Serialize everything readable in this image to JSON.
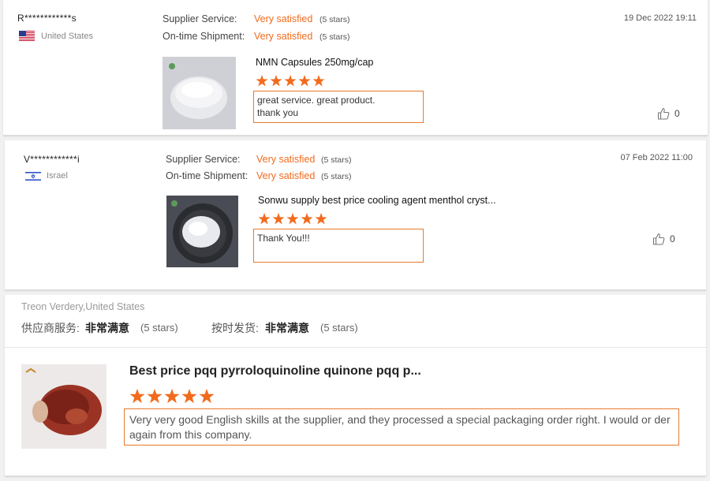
{
  "colors": {
    "accent": "#f26b1d",
    "star": "#f26b1d",
    "border": "#e77a2d"
  },
  "reviews": [
    {
      "user": "R************s",
      "country": "United States",
      "flag": "us-flag",
      "supplier_label": "Supplier Service:",
      "supplier_value": "Very satisfied",
      "supplier_stars": "(5 stars)",
      "shipment_label": "On-time Shipment:",
      "shipment_value": "Very satisfied",
      "shipment_stars": "(5 stars)",
      "date": "19 Dec 2022 19:11",
      "product": "NMN Capsules 250mg/cap",
      "rating": 5,
      "comment": "great service.  great product.\nthank you",
      "likes": "0"
    },
    {
      "user": "V************i",
      "country": "Israel",
      "flag": "israel-flag",
      "supplier_label": "Supplier Service:",
      "supplier_value": "Very satisfied",
      "supplier_stars": "(5 stars)",
      "shipment_label": "On-time Shipment:",
      "shipment_value": "Very satisfied",
      "shipment_stars": "(5 stars)",
      "date": "07 Feb 2022 11:00",
      "product": "Sonwu supply best price cooling agent menthol cryst...",
      "rating": 5,
      "comment": "Thank You!!!",
      "likes": "0"
    },
    {
      "user": "Treon Verdery,United States",
      "supplier_label": "供应商服务:",
      "supplier_value": "非常满意",
      "supplier_stars": "(5 stars)",
      "shipment_label": "按时发货:",
      "shipment_value": "非常满意",
      "shipment_stars": "(5 stars)",
      "product": "Best price pqq pyrroloquinoline quinone pqq p...",
      "rating": 5,
      "comment": "Very very good English skills at the supplier, and they processed a special packaging order right. I would or der again from this company."
    }
  ]
}
